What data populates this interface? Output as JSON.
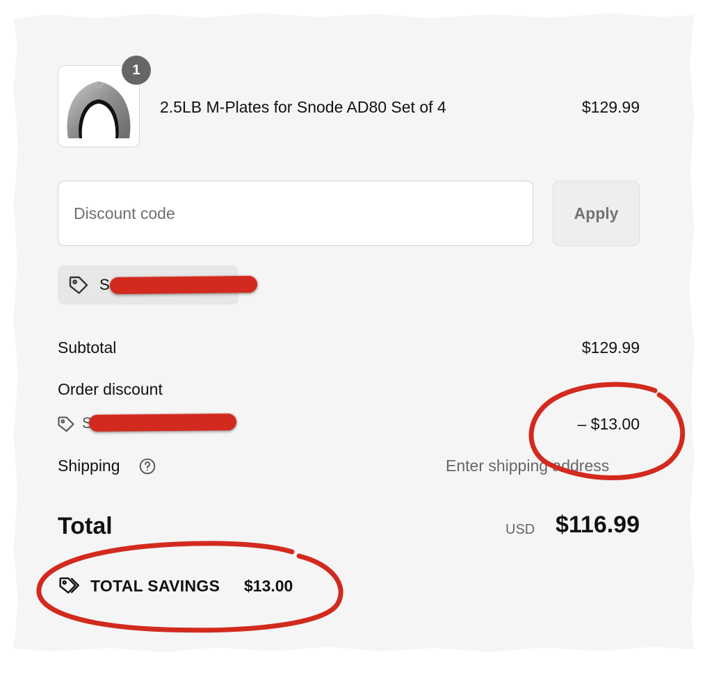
{
  "product": {
    "quantity": "1",
    "name": "2.5LB M-Plates for Snode AD80 Set of 4",
    "price": "$129.99"
  },
  "discount_form": {
    "placeholder": "Discount code",
    "apply_label": "Apply"
  },
  "applied_code": {
    "visible_prefix": "S",
    "icon": "tag-icon"
  },
  "summary": {
    "subtotal_label": "Subtotal",
    "subtotal_value": "$129.99",
    "order_discount_label": "Order discount",
    "discount_code_prefix": "S",
    "discount_value": "– $13.00",
    "shipping_label": "Shipping",
    "shipping_help_icon": "question-circle-icon",
    "shipping_value": "Enter shipping address",
    "total_label": "Total",
    "currency": "USD",
    "total_value": "$116.99"
  },
  "savings": {
    "icon": "tags-icon",
    "label": "TOTAL SAVINGS",
    "value": "$13.00"
  },
  "colors": {
    "panel": "#f5f5f5",
    "annotation_red": "#d22a1e",
    "muted_text": "#666666"
  }
}
